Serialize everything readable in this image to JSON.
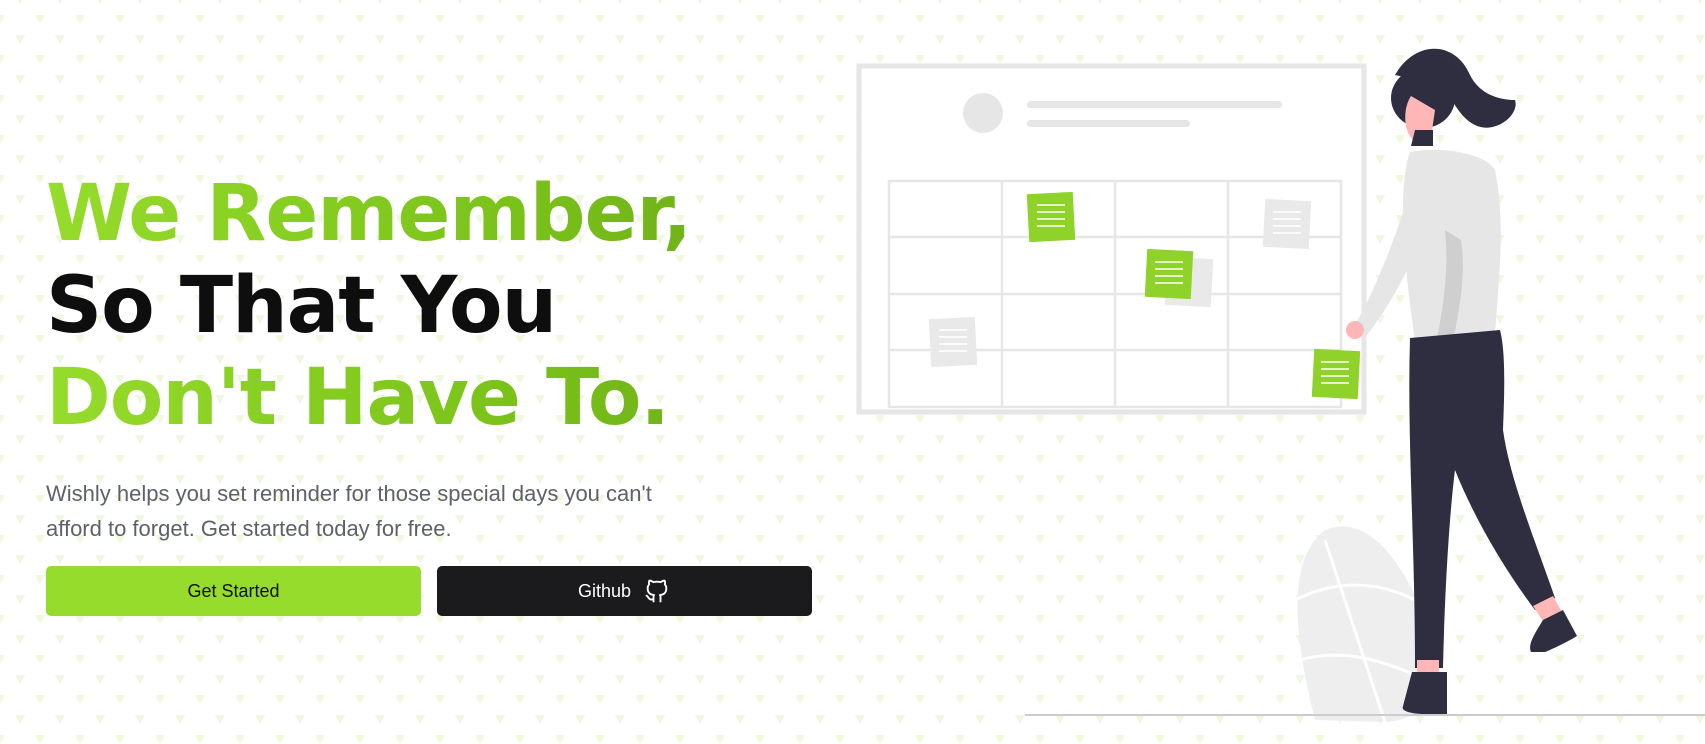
{
  "hero": {
    "headline_line1": "We Remember,",
    "headline_line2": "So That You",
    "headline_line3": "Don't Have To.",
    "subtitle": "Wishly helps you set reminder for those special days you can't afford to forget. Get started today for free.",
    "cta_primary_label": "Get Started",
    "cta_secondary_label": "Github",
    "cta_secondary_icon": "github-icon"
  },
  "colors": {
    "accent": "#95dc2c",
    "headline_dark": "#0e0e0e",
    "subtitle_text": "#5e6169",
    "dark_button": "#1b1b1d",
    "pattern": "#f0f9df"
  },
  "illustration": {
    "description_icon": "woman-with-calendar-board-illustration"
  }
}
